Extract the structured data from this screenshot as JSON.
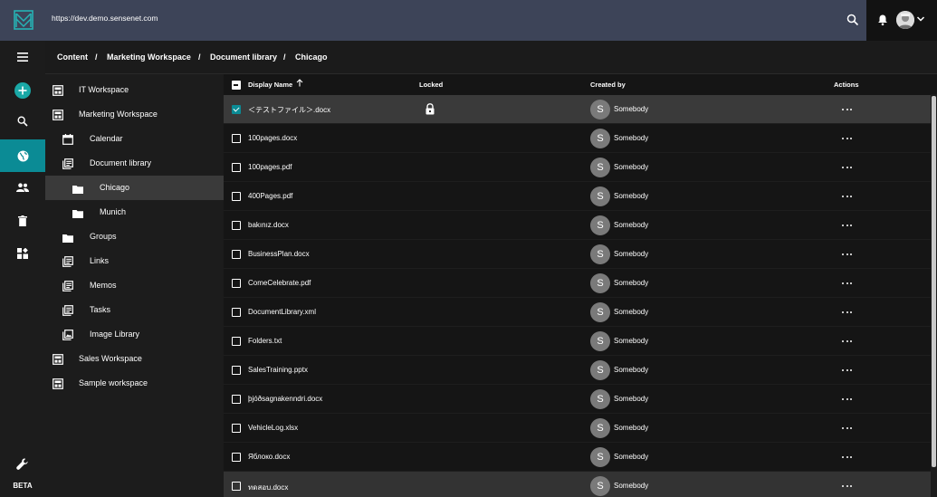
{
  "topbar": {
    "url": "https://dev.demo.sensenet.com"
  },
  "rail": {
    "items": [
      {
        "name": "menu-icon",
        "active": false
      },
      {
        "name": "add-icon",
        "active": false
      },
      {
        "name": "search-icon",
        "active": false
      },
      {
        "name": "globe-icon",
        "active": true
      },
      {
        "name": "users-icon",
        "active": false
      },
      {
        "name": "trash-icon",
        "active": false
      },
      {
        "name": "widgets-icon",
        "active": false
      },
      {
        "name": "wrench-icon",
        "active": false
      }
    ],
    "beta_label": "BETA"
  },
  "breadcrumb": {
    "items": [
      "Content",
      "Marketing Workspace",
      "Document library",
      "Chicago"
    ],
    "separator": "/"
  },
  "tree": {
    "items": [
      {
        "label": "IT Workspace",
        "icon": "workspace-icon",
        "level": 0
      },
      {
        "label": "Marketing Workspace",
        "icon": "workspace-icon",
        "level": 0
      },
      {
        "label": "Calendar",
        "icon": "calendar-icon",
        "level": 1
      },
      {
        "label": "Document library",
        "icon": "library-icon",
        "level": 1
      },
      {
        "label": "Chicago",
        "icon": "folder-icon",
        "level": 2,
        "active": true
      },
      {
        "label": "Munich",
        "icon": "folder-icon",
        "level": 2
      },
      {
        "label": "Groups",
        "icon": "folder-icon",
        "level": 1
      },
      {
        "label": "Links",
        "icon": "library-icon",
        "level": 1
      },
      {
        "label": "Memos",
        "icon": "library-icon",
        "level": 1
      },
      {
        "label": "Tasks",
        "icon": "library-icon",
        "level": 1
      },
      {
        "label": "Image Library",
        "icon": "image-library-icon",
        "level": 1
      },
      {
        "label": "Sales Workspace",
        "icon": "workspace-icon",
        "level": 0
      },
      {
        "label": "Sample workspace",
        "icon": "workspace-icon",
        "level": 0
      }
    ]
  },
  "table": {
    "columns": {
      "display_name": "Display Name",
      "locked": "Locked",
      "created_by": "Created by",
      "actions": "Actions"
    },
    "sort_icon": "arrow-up-icon",
    "rows": [
      {
        "name": "＜テストファイル＞.docx",
        "locked": true,
        "creator": "Somebody",
        "initial": "S",
        "checked": true,
        "state": "selected"
      },
      {
        "name": "100pages.docx",
        "locked": false,
        "creator": "Somebody",
        "initial": "S",
        "checked": false,
        "state": ""
      },
      {
        "name": "100pages.pdf",
        "locked": false,
        "creator": "Somebody",
        "initial": "S",
        "checked": false,
        "state": ""
      },
      {
        "name": "400Pages.pdf",
        "locked": false,
        "creator": "Somebody",
        "initial": "S",
        "checked": false,
        "state": ""
      },
      {
        "name": "bakınız.docx",
        "locked": false,
        "creator": "Somebody",
        "initial": "S",
        "checked": false,
        "state": ""
      },
      {
        "name": "BusinessPlan.docx",
        "locked": false,
        "creator": "Somebody",
        "initial": "S",
        "checked": false,
        "state": ""
      },
      {
        "name": "ComeCelebrate.pdf",
        "locked": false,
        "creator": "Somebody",
        "initial": "S",
        "checked": false,
        "state": ""
      },
      {
        "name": "DocumentLibrary.xml",
        "locked": false,
        "creator": "Somebody",
        "initial": "S",
        "checked": false,
        "state": ""
      },
      {
        "name": "Folders.txt",
        "locked": false,
        "creator": "Somebody",
        "initial": "S",
        "checked": false,
        "state": ""
      },
      {
        "name": "SalesTraining.pptx",
        "locked": false,
        "creator": "Somebody",
        "initial": "S",
        "checked": false,
        "state": ""
      },
      {
        "name": "þjóðsagnakenndri.docx",
        "locked": false,
        "creator": "Somebody",
        "initial": "S",
        "checked": false,
        "state": ""
      },
      {
        "name": "VehicleLog.xlsx",
        "locked": false,
        "creator": "Somebody",
        "initial": "S",
        "checked": false,
        "state": ""
      },
      {
        "name": "Яблоко.docx",
        "locked": false,
        "creator": "Somebody",
        "initial": "S",
        "checked": false,
        "state": ""
      },
      {
        "name": "ทดสอบ.docx",
        "locked": false,
        "creator": "Somebody",
        "initial": "S",
        "checked": false,
        "state": "hover"
      }
    ]
  },
  "colors": {
    "topbar": "#3d4458",
    "accent": "#0b8b95",
    "rail": "#1c1c1c",
    "selected_row": "#3a3a3a"
  }
}
